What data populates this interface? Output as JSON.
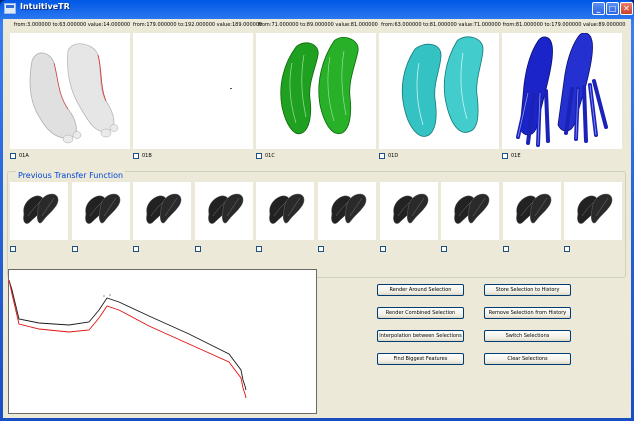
{
  "window": {
    "title": "IntuitiveTR",
    "min_glyph": "_",
    "max_glyph": "□",
    "close_glyph": "✕"
  },
  "previews": [
    {
      "caption": "from:3.000000 to:63.000000 value:14.000000",
      "checkbox_label": "01A",
      "color": "#dcdcdc"
    },
    {
      "caption": "from:179.000000 to:192.000000 value:189.000000",
      "checkbox_label": "01B",
      "color": "#ffffff"
    },
    {
      "caption": "from:71.000000 to:89.000000 value:81.000000",
      "checkbox_label": "01C",
      "color": "#1aa51a"
    },
    {
      "caption": "from:63.000000 to:81.000000 value:71.000000",
      "checkbox_label": "01D",
      "color": "#3ac9c9"
    },
    {
      "caption": "from:81.000000 to:179.000000 value:89.000000",
      "checkbox_label": "01E",
      "color": "#1d24c4"
    }
  ],
  "history": {
    "title": "Previous Transfer Function",
    "count": 10
  },
  "buttons": {
    "render_around": "Render Around Selection",
    "render_combined": "Render Combined Selection",
    "interpolation": "Interpolation between Selections",
    "find_biggest": "Find Biggest Features",
    "store_history": "Store Selection to History",
    "remove_history": "Remove Selection from History",
    "switch": "Switch Selections",
    "clear": "Clear Selections"
  },
  "colors": {
    "curve_primary": "#1a1a1a",
    "curve_secondary": "#e01010"
  }
}
